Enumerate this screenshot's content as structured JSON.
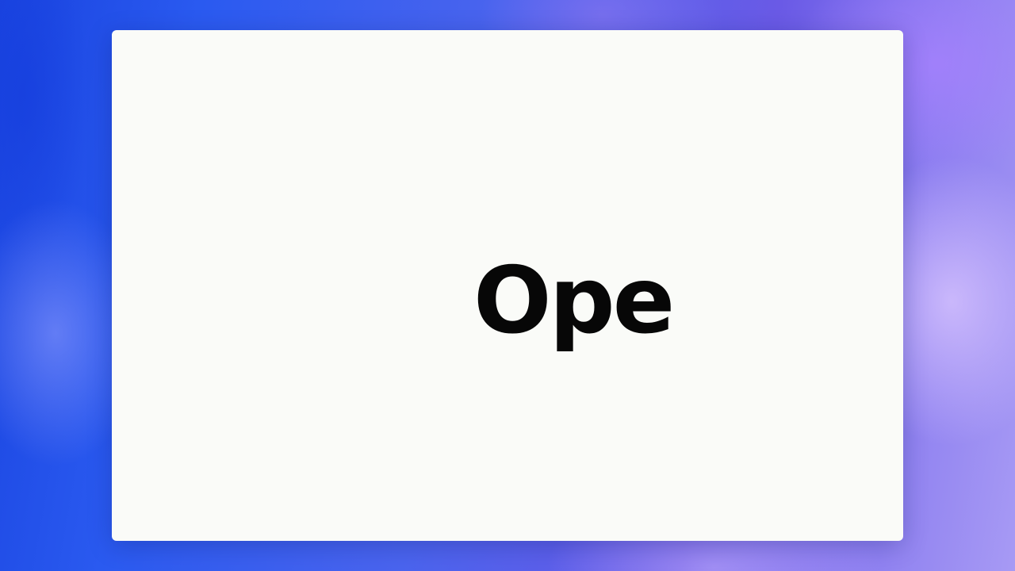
{
  "slide": {
    "wordmark_text": "Ope"
  },
  "colors": {
    "card_background": "#fafbf8",
    "text": "#070707",
    "backdrop_blue": "#2a5af0",
    "backdrop_violet": "#8a7cf0"
  }
}
